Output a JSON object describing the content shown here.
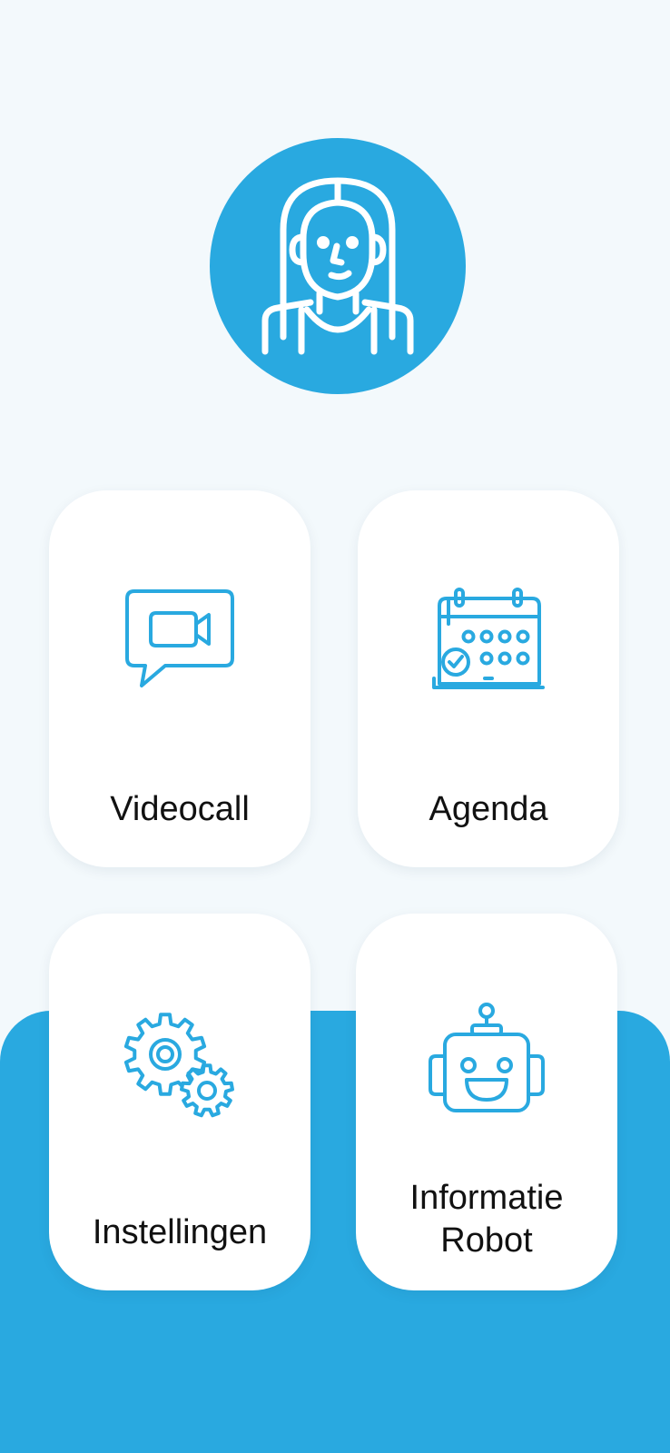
{
  "colors": {
    "accent": "#29a9e0",
    "background": "#f3f9fc",
    "tile": "#ffffff",
    "text": "#111111"
  },
  "profile": {
    "avatar_icon": "woman-avatar-icon"
  },
  "tiles": [
    {
      "id": "videocall",
      "icon": "video-chat-icon",
      "label": "Videocall"
    },
    {
      "id": "agenda",
      "icon": "calendar-icon",
      "label": "Agenda"
    },
    {
      "id": "instellingen",
      "icon": "gears-icon",
      "label": "Instellingen"
    },
    {
      "id": "informatie",
      "icon": "robot-icon",
      "label_lines": [
        "Informatie",
        "Robot"
      ]
    }
  ]
}
